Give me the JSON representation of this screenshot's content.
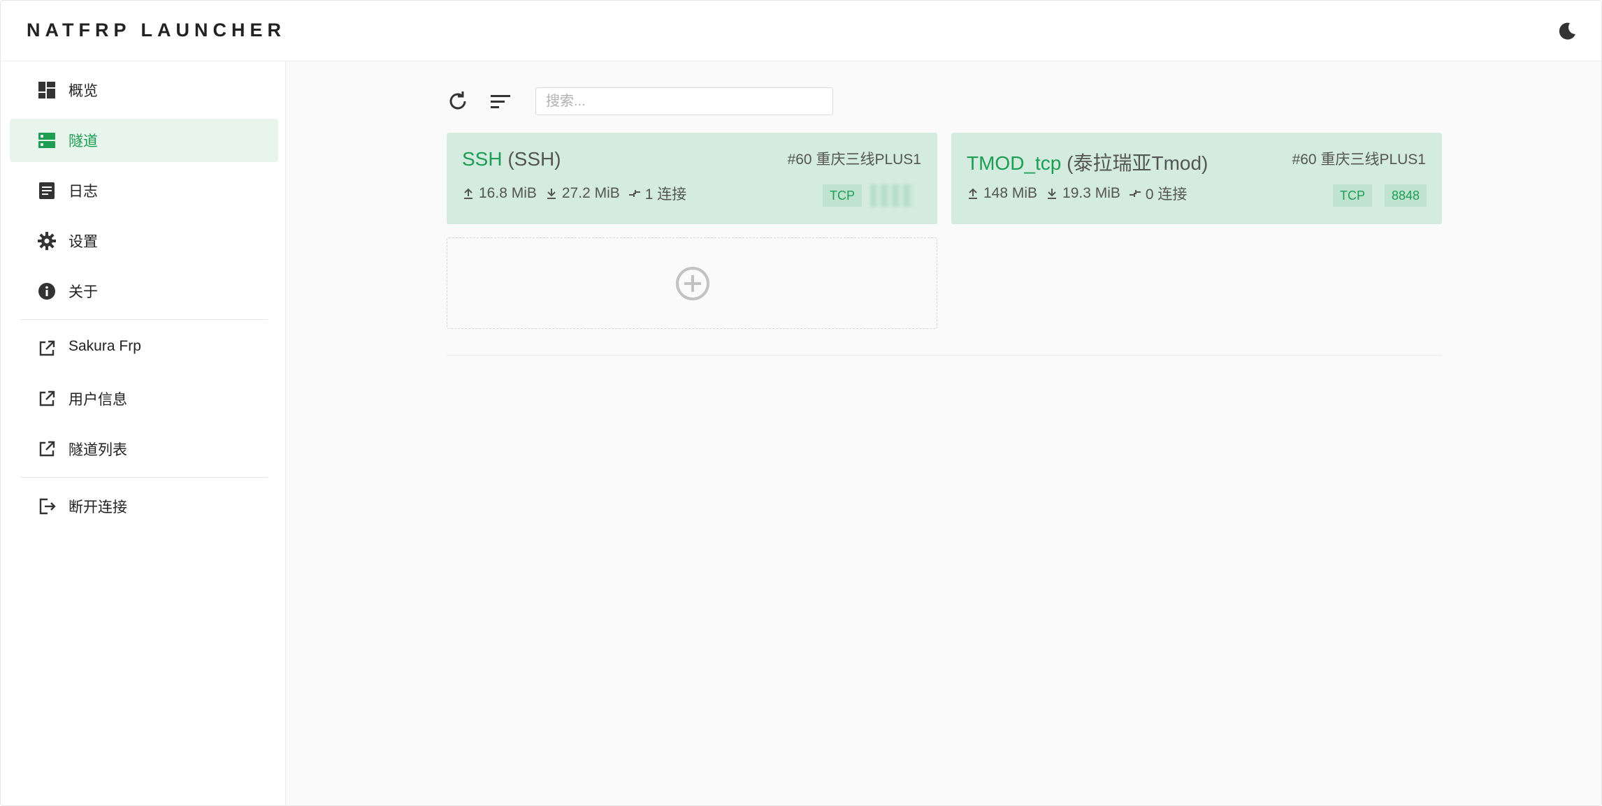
{
  "app": {
    "title": "NATFRP LAUNCHER"
  },
  "header": {
    "theme_toggle_icon": "moon-icon"
  },
  "sidebar": {
    "items": [
      {
        "label": "概览",
        "icon": "dashboard-icon",
        "active": false
      },
      {
        "label": "隧道",
        "icon": "server-icon",
        "active": true
      },
      {
        "label": "日志",
        "icon": "log-icon",
        "active": false
      },
      {
        "label": "设置",
        "icon": "gear-icon",
        "active": false
      },
      {
        "label": "关于",
        "icon": "info-icon",
        "active": false
      }
    ],
    "links": [
      {
        "label": "Sakura Frp",
        "icon": "external-link-icon"
      },
      {
        "label": "用户信息",
        "icon": "external-link-icon"
      },
      {
        "label": "隧道列表",
        "icon": "external-link-icon"
      }
    ],
    "logout": {
      "label": "断开连接",
      "icon": "logout-icon"
    }
  },
  "toolbar": {
    "refresh_icon": "refresh-icon",
    "sort_icon": "sort-icon",
    "search_placeholder": "搜索..."
  },
  "tunnels": [
    {
      "name": "SSH",
      "type_label": "(SSH)",
      "node": "#60 重庆三线PLUS1",
      "upload": "16.8 MiB",
      "download": "27.2 MiB",
      "connections": "1 连接",
      "protocol": "TCP",
      "port": ""
    },
    {
      "name": "TMOD_tcp",
      "type_label": "(泰拉瑞亚Tmod)",
      "node": "#60 重庆三线PLUS1",
      "upload": "148 MiB",
      "download": "19.3 MiB",
      "connections": "0 连接",
      "protocol": "TCP",
      "port": "8848"
    }
  ],
  "colors": {
    "accent": "#1d9e53",
    "card_bg": "#d4ebe0",
    "active_nav_bg": "#e7f5ec"
  }
}
